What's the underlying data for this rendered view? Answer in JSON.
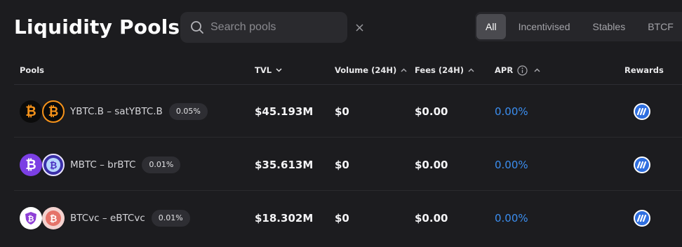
{
  "page": {
    "title": "Liquidity Pools"
  },
  "search": {
    "placeholder": "Search pools",
    "value": ""
  },
  "filters": {
    "tabs": [
      "All",
      "Incentivised",
      "Stables",
      "BTCF"
    ],
    "active": "All"
  },
  "table": {
    "headers": {
      "pools": "Pools",
      "tvl": "TVL",
      "volume": "Volume (24H)",
      "fees": "Fees (24H)",
      "apr": "APR",
      "rewards": "Rewards"
    },
    "rows": [
      {
        "pair": "YBTC.B – satYBTC.B",
        "fee": "0.05%",
        "tvl": "$45.193M",
        "volume": "$0",
        "fees": "$0.00",
        "apr": "0.00%",
        "coin_a": {
          "icon": "bitcoin-icon",
          "bg": "#0b0b0b",
          "fg": "#f7931a"
        },
        "coin_b": {
          "icon": "bitcoin-icon",
          "bg": "#0b0b0b",
          "fg": "#f7931a",
          "ring": "#f7931a"
        }
      },
      {
        "pair": "MBTC – brBTC",
        "fee": "0.01%",
        "tvl": "$35.613M",
        "volume": "$0",
        "fees": "$0.00",
        "apr": "0.00%",
        "coin_a": {
          "icon": "bitcoin-icon",
          "bg": "#7b3fe4",
          "fg": "#ffffff"
        },
        "coin_b": {
          "icon": "bitcoin-icon",
          "bg": "#6a4cf0",
          "fg": "#ffffff",
          "ring": "#ffffff"
        }
      },
      {
        "pair": "BTCvc – eBTCvc",
        "fee": "0.01%",
        "tvl": "$18.302M",
        "volume": "$0",
        "fees": "$0.00",
        "apr": "0.00%",
        "coin_a": {
          "icon": "bitcoin-shield-icon",
          "bg": "#ffffff",
          "fg": "#8e3fd6"
        },
        "coin_b": {
          "icon": "bitcoin-icon",
          "bg": "#f4d2cf",
          "fg": "#d9534f"
        }
      }
    ]
  },
  "colors": {
    "background": "#1c1c1f",
    "accent_apr": "#3b8ef0",
    "reward_badge": "#2f6fe0"
  }
}
